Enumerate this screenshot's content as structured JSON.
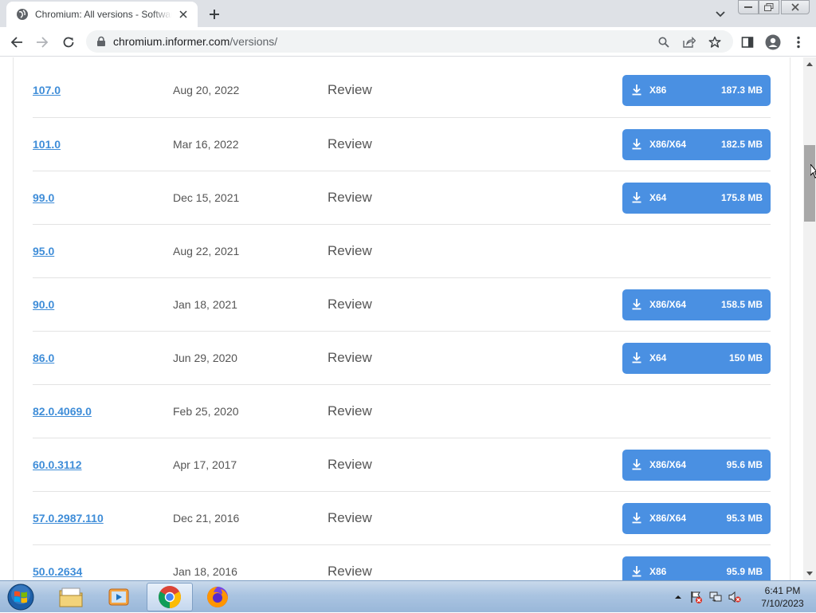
{
  "browser": {
    "tab_title": "Chromium: All versions - Software Informer",
    "url_host": "chromium.informer.com",
    "url_path": "/versions/"
  },
  "versions": [
    {
      "version": "107.0",
      "date": "Aug 20, 2022",
      "review": "Review",
      "download": {
        "arch": "X86",
        "size": "187.3 MB"
      }
    },
    {
      "version": "101.0",
      "date": "Mar 16, 2022",
      "review": "Review",
      "download": {
        "arch": "X86/X64",
        "size": "182.5 MB"
      }
    },
    {
      "version": "99.0",
      "date": "Dec 15, 2021",
      "review": "Review",
      "download": {
        "arch": "X64",
        "size": "175.8 MB"
      }
    },
    {
      "version": "95.0",
      "date": "Aug 22, 2021",
      "review": "Review",
      "download": null
    },
    {
      "version": "90.0",
      "date": "Jan 18, 2021",
      "review": "Review",
      "download": {
        "arch": "X86/X64",
        "size": "158.5 MB"
      }
    },
    {
      "version": "86.0",
      "date": "Jun 29, 2020",
      "review": "Review",
      "download": {
        "arch": "X64",
        "size": "150 MB"
      }
    },
    {
      "version": "82.0.4069.0",
      "date": "Feb 25, 2020",
      "review": "Review",
      "download": null
    },
    {
      "version": "60.0.3112",
      "date": "Apr 17, 2017",
      "review": "Review",
      "download": {
        "arch": "X86/X64",
        "size": "95.6 MB"
      }
    },
    {
      "version": "57.0.2987.110",
      "date": "Dec 21, 2016",
      "review": "Review",
      "download": {
        "arch": "X86/X64",
        "size": "95.3 MB"
      }
    },
    {
      "version": "50.0.2634",
      "date": "Jan 18, 2016",
      "review": "Review",
      "download": {
        "arch": "X86",
        "size": "95.9 MB"
      }
    }
  ],
  "taskbar": {
    "apps": [
      "windows-explorer-icon",
      "media-player-icon",
      "chrome-icon",
      "firefox-icon"
    ],
    "time": "6:41 PM",
    "date": "7/10/2023"
  },
  "colors": {
    "link": "#3f8dd8",
    "download_button": "#4a90e2",
    "tab_strip": "#dee1e6"
  }
}
